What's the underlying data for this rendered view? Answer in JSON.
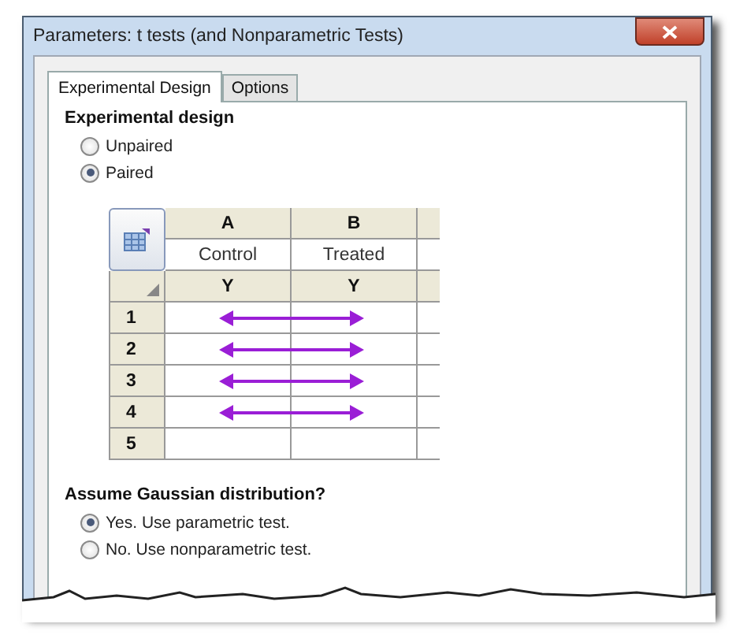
{
  "window": {
    "title": "Parameters: t tests (and Nonparametric Tests)"
  },
  "tabs": [
    {
      "label": "Experimental Design",
      "selected": true
    },
    {
      "label": "Options",
      "selected": false
    }
  ],
  "design": {
    "heading": "Experimental design",
    "options": [
      {
        "label": "Unpaired",
        "selected": false
      },
      {
        "label": "Paired",
        "selected": true
      }
    ]
  },
  "grid": {
    "columns": [
      {
        "letter": "A",
        "title": "Control",
        "type": "Y"
      },
      {
        "letter": "B",
        "title": "Treated",
        "type": "Y"
      }
    ],
    "rows": [
      {
        "number": "1",
        "paired_arrow": true
      },
      {
        "number": "2",
        "paired_arrow": true
      },
      {
        "number": "3",
        "paired_arrow": true
      },
      {
        "number": "4",
        "paired_arrow": true
      },
      {
        "number": "5",
        "paired_arrow": false
      }
    ]
  },
  "gaussian": {
    "heading": "Assume Gaussian distribution?",
    "options": [
      {
        "label": "Yes. Use parametric test.",
        "selected": true
      },
      {
        "label": "No. Use nonparametric test.",
        "selected": false
      }
    ]
  }
}
